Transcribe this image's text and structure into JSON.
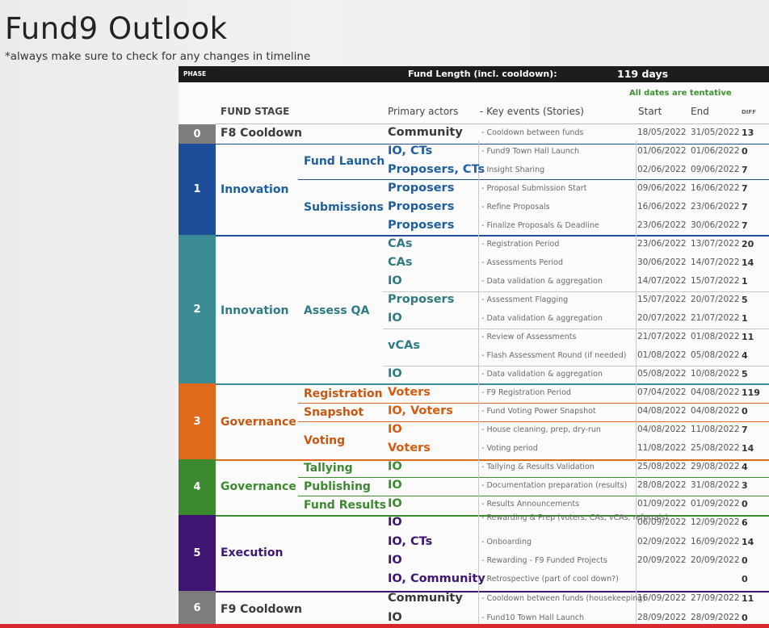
{
  "title": "Fund9 Outlook",
  "subtitle": "*always make sure to check for any changes in timeline",
  "header": {
    "phase": "PHASE",
    "fund_length_label": "Fund Length (incl. cooldown):",
    "days": "119 days"
  },
  "tentative": "All dates are tentative",
  "columns": {
    "stage": "FUND STAGE",
    "actors": "Primary actors",
    "events": "- Key events (Stories)",
    "start": "Start",
    "end": "End",
    "diff": "DIFF"
  },
  "colors": {
    "phase0": "#7d7d7d",
    "phase1": "#1e4e9a",
    "phase2": "#3b8c95",
    "phase3": "#de6a1b",
    "phase4": "#3c8a2f",
    "phase5": "#3f1573",
    "phase6": "#7d7d7d",
    "blue_text": "#1e5fa0",
    "orange_text": "#d35c12",
    "green_text": "#3c8a2f",
    "purple_text": "#3f1573"
  },
  "bands": [
    {
      "num": "0"
    },
    {
      "num": "1"
    },
    {
      "num": "2"
    },
    {
      "num": "3"
    },
    {
      "num": "4"
    },
    {
      "num": "5"
    },
    {
      "num": "6"
    }
  ],
  "stages": [
    {
      "text": "F8 Cooldown"
    },
    {
      "text": "Innovation"
    },
    {
      "text": "Innovation"
    },
    {
      "text": "Governance"
    },
    {
      "text": "Governance"
    },
    {
      "text": "Execution"
    },
    {
      "text": "F9 Cooldown"
    }
  ],
  "substages": [
    {
      "text": "Fund Launch"
    },
    {
      "text": "Submissions"
    },
    {
      "text": "Assess QA"
    },
    {
      "text": "Registration"
    },
    {
      "text": "Snapshot"
    },
    {
      "text": "Voting"
    },
    {
      "text": "Tallying"
    },
    {
      "text": "Publishing"
    },
    {
      "text": "Fund Results"
    }
  ],
  "rows": [
    {
      "actor": "Community",
      "event": "- Cooldown between funds",
      "start": "18/05/2022",
      "end": "31/05/2022",
      "diff": "13"
    },
    {
      "actor": "IO, CTs",
      "event": "- Fund9 Town Hall Launch",
      "start": "01/06/2022",
      "end": "01/06/2022",
      "diff": "0"
    },
    {
      "actor": "Proposers, CTs",
      "event": "- Insight Sharing",
      "start": "02/06/2022",
      "end": "09/06/2022",
      "diff": "7"
    },
    {
      "actor": "Proposers",
      "event": "- Proposal Submission Start",
      "start": "09/06/2022",
      "end": "16/06/2022",
      "diff": "7"
    },
    {
      "actor": "Proposers",
      "event": "- Refine Proposals",
      "start": "16/06/2022",
      "end": "23/06/2022",
      "diff": "7"
    },
    {
      "actor": "Proposers",
      "event": "- Finalize Proposals & Deadline",
      "start": "23/06/2022",
      "end": "30/06/2022",
      "diff": "7"
    },
    {
      "actor": "CAs",
      "event": "- Registration Period",
      "start": "23/06/2022",
      "end": "13/07/2022",
      "diff": "20"
    },
    {
      "actor": "CAs",
      "event": "- Assessments Period",
      "start": "30/06/2022",
      "end": "14/07/2022",
      "diff": "14"
    },
    {
      "actor": "IO",
      "event": "- Data validation & aggregation",
      "start": "14/07/2022",
      "end": "15/07/2022",
      "diff": "1"
    },
    {
      "actor": "Proposers",
      "event": "- Assessment Flagging",
      "start": "15/07/2022",
      "end": "20/07/2022",
      "diff": "5"
    },
    {
      "actor": "IO",
      "event": "- Data validation & aggregation",
      "start": "20/07/2022",
      "end": "21/07/2022",
      "diff": "1"
    },
    {
      "actor": "vCAs",
      "event": "- Review of Assessments",
      "start": "21/07/2022",
      "end": "01/08/2022",
      "diff": "11"
    },
    {
      "actor": "",
      "event": "- Flash Assessment Round (if needed)",
      "start": "01/08/2022",
      "end": "05/08/2022",
      "diff": "4"
    },
    {
      "actor": "IO",
      "event": "- Data validation & aggregation",
      "start": "05/08/2022",
      "end": "10/08/2022",
      "diff": "5"
    },
    {
      "actor": "Voters",
      "event": "- F9 Registration Period",
      "start": "07/04/2022",
      "end": "04/08/2022",
      "diff": "119"
    },
    {
      "actor": "IO, Voters",
      "event": "- Fund Voting Power Snapshot",
      "start": "04/08/2022",
      "end": "04/08/2022",
      "diff": "0"
    },
    {
      "actor": "IO",
      "event": "- House cleaning, prep, dry-run",
      "start": "04/08/2022",
      "end": "11/08/2022",
      "diff": "7"
    },
    {
      "actor": "Voters",
      "event": "- Voting period",
      "start": "11/08/2022",
      "end": "25/08/2022",
      "diff": "14"
    },
    {
      "actor": "IO",
      "event": "- Tallying & Results Validation",
      "start": "25/08/2022",
      "end": "29/08/2022",
      "diff": "4"
    },
    {
      "actor": "IO",
      "event": "- Documentation preparation (results)",
      "start": "28/08/2022",
      "end": "31/08/2022",
      "diff": "3"
    },
    {
      "actor": "IO",
      "event": "- Results Announcements",
      "start": "01/09/2022",
      "end": "01/09/2022",
      "diff": "0"
    },
    {
      "actor": "IO",
      "event": "- Rewarding & Prep (voters, CAs, vCAs, referrals)",
      "start": "06/09/2022",
      "end": "12/09/2022",
      "diff": "6"
    },
    {
      "actor": "IO, CTs",
      "event": "- Onboarding",
      "start": "02/09/2022",
      "end": "16/09/2022",
      "diff": "14"
    },
    {
      "actor": "IO",
      "event": "- Rewarding - F9 Funded Projects",
      "start": "20/09/2022",
      "end": "20/09/2022",
      "diff": "0"
    },
    {
      "actor": "IO, Community",
      "event": "- Retrospective (part of cool down?)",
      "start": "",
      "end": "",
      "diff": "0"
    },
    {
      "actor": "Community",
      "event": "- Cooldown between funds (housekeeping)",
      "start": "16/09/2022",
      "end": "27/09/2022",
      "diff": "11"
    },
    {
      "actor": "IO",
      "event": "- Fund10 Town Hall Launch",
      "start": "28/09/2022",
      "end": "28/09/2022",
      "diff": "0"
    }
  ]
}
